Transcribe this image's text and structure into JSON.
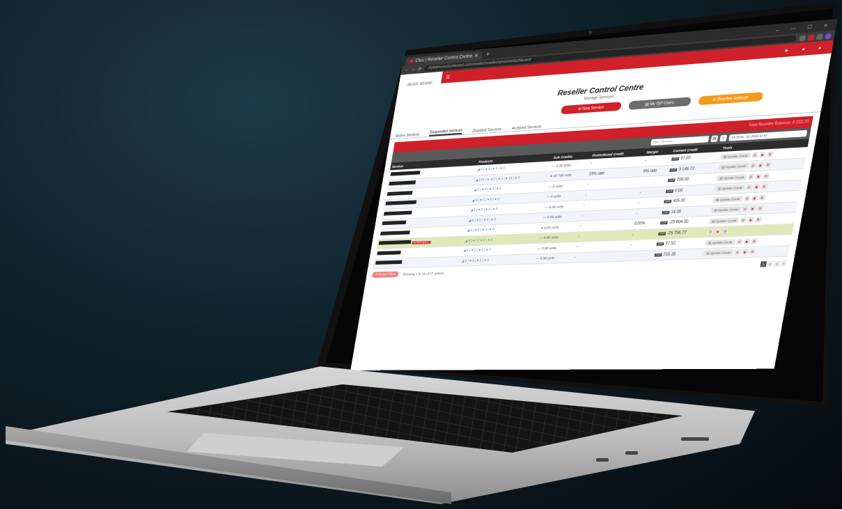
{
  "browser": {
    "tab_title": "Cluu | Reseller Control Centre",
    "url": "digitalmusicdashboard.com/reseller/reseller/services/dashboard/",
    "window_controls": "⌄ — ☐ ✕"
  },
  "app": {
    "logo_text": "MUSIC BRAND",
    "title": "Reseller Control Centre",
    "subtitle": "Manage Services",
    "buttons": {
      "new_service": "⊕ New Service",
      "my_isp_users": "▤ My ISP Users",
      "reseller_settings": "⚙ Reseller Settings"
    },
    "subtabs": [
      "Active Services",
      "Suspended Services",
      "Disabled Services",
      "Archived Services"
    ],
    "red_header_text": "Total Reseller Balance: 8 222.70",
    "filter": {
      "placeholder": "Filter services...",
      "date": "01.2023 - 01.2023 11:07"
    },
    "columns": [
      "Service",
      "Products",
      "Sub Credits",
      "Promotional Credit",
      "Margin",
      "Current Credit",
      "Tools"
    ]
  },
  "rows": [
    {
      "products": "◢ 0 | ● 0 | ● 0 | ● 0",
      "sub": "— 0.00 units",
      "promo": "-",
      "margin": "-",
      "cur": "ZAR",
      "credit": "97.00",
      "hl": false,
      "badge": ""
    },
    {
      "products": "◢ 172 | ● 417 | ● 2 | ● 10 | ● 0",
      "sub": "● 10 700 units",
      "promo": "19% rate",
      "margin": "5% rate",
      "cur": "ZAR",
      "credit": "3 148.72",
      "hl": false,
      "badge": ""
    },
    {
      "products": "◢ 0 | ● 0 | ● 0 | ● 0",
      "sub": "— 0 units",
      "promo": "-",
      "margin": "",
      "cur": "ZAR",
      "credit": "200.00",
      "hl": false,
      "badge": ""
    },
    {
      "products": "◢ 5 | ● 0 | ● 0 | ● 0",
      "sub": "— 0 units",
      "promo": "-",
      "margin": "-",
      "cur": "ZAR",
      "credit": "0.00",
      "hl": false,
      "badge": ""
    },
    {
      "products": "◢ 1 | ● 0 | ● 0 | ● 0",
      "sub": "— 0.00 units",
      "promo": "-",
      "margin": "-",
      "cur": "ZAR",
      "credit": "425.00",
      "hl": false,
      "badge": ""
    },
    {
      "products": "◢ 8 | ● 0 | ● 0 | ● 0",
      "sub": "— 0.00 units",
      "promo": "-",
      "margin": "-",
      "cur": "ZAR",
      "credit": "14.00",
      "hl": false,
      "badge": ""
    },
    {
      "products": "◢ 4 | ● 0 | ● 0 | ● 0",
      "sub": "● 0.00 units",
      "promo": "-",
      "margin": "0.00%",
      "cur": "ZAR",
      "credit": "-25 804.00",
      "hl": false,
      "badge": ""
    },
    {
      "products": "◢ 5 | ● 0 | ● 0 | ● 0",
      "sub": "— 0.00 units",
      "promo": "-",
      "margin": "-",
      "cur": "ZAR",
      "credit": "-25 796.77",
      "hl": true,
      "badge": "SUSPENDED"
    },
    {
      "products": "◢ 0 | ● 0 | ● 0 | ● 0",
      "sub": "— 0.00 units",
      "promo": "-",
      "margin": "-",
      "cur": "ZAR",
      "credit": "97.52",
      "hl": false,
      "badge": ""
    },
    {
      "products": "◢ 2 | ● 0 | ● 0 | ● 0",
      "sub": "— 0.00 units",
      "promo": "-",
      "margin": "",
      "cur": "ZAR",
      "credit": "715.26",
      "hl": false,
      "badge": ""
    }
  ],
  "update_label": "▤ Update Credit",
  "footer": {
    "showing": "Showing 1 to 10 of 27 entries",
    "reset": "⟲ Reset Filters",
    "pages": [
      "1",
      "2",
      "3",
      "»"
    ]
  }
}
